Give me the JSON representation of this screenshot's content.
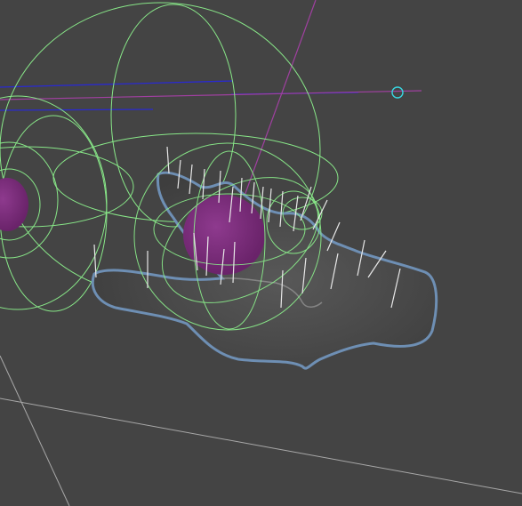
{
  "viewport": {
    "background_color": "#444444",
    "grid_color": "#9a9a9a",
    "deformer_color": "#8cf08c",
    "muscle_color": "#7a2f7a",
    "surface_color": "#4a4a4a",
    "surface_outline_color": "#6e8fb4",
    "normal_line_color": "#e8e8e8",
    "axis_line_color": "#2a2ad0",
    "pivot_line_color": "#a040a0",
    "handle_color": "#38d6e0"
  },
  "icons": {
    "manipulator_handle": "circle-handle-icon"
  }
}
